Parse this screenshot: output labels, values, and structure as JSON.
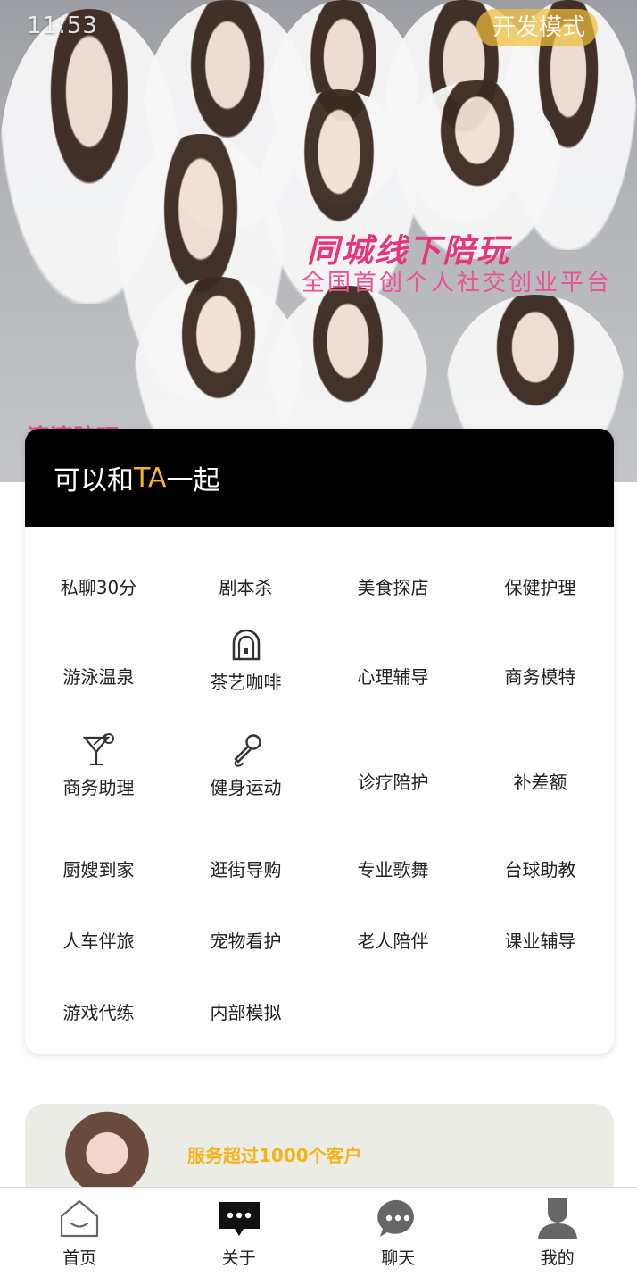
{
  "status_bar": {
    "time": "11:53"
  },
  "hero": {
    "dev_badge": "开发模式",
    "headline": "同城线下陪玩",
    "subline": "全国首创个人社交创业平台",
    "corner_text": "滴滴陪玩"
  },
  "card": {
    "title_prefix": "可以和",
    "title_accent": "TA",
    "title_suffix": "一起",
    "accent_color": "#f5b52a",
    "items": [
      {
        "label": "私聊30分"
      },
      {
        "label": "剧本杀"
      },
      {
        "label": "美食探店"
      },
      {
        "label": "保健护理"
      },
      {
        "label": "游泳温泉"
      },
      {
        "label": "茶艺咖啡",
        "icon": "door-lock-icon"
      },
      {
        "label": "心理辅导"
      },
      {
        "label": "商务模特"
      },
      {
        "label": "商务助理",
        "icon": "cocktail-icon"
      },
      {
        "label": "健身运动",
        "icon": "microphone-icon"
      },
      {
        "label": "诊疗陪护"
      },
      {
        "label": "补差额"
      },
      {
        "label": "厨嫂到家"
      },
      {
        "label": "逛街导购"
      },
      {
        "label": "专业歌舞"
      },
      {
        "label": "台球助教"
      },
      {
        "label": "人车伴旅"
      },
      {
        "label": "宠物看护"
      },
      {
        "label": "老人陪伴"
      },
      {
        "label": "课业辅导"
      },
      {
        "label": "游戏代练"
      },
      {
        "label": "内部模拟"
      }
    ]
  },
  "promo": {
    "text": "服务超过1000个客户",
    "color": "#f3b41b"
  },
  "nav": {
    "items": [
      {
        "label": "首页",
        "icon": "home-icon"
      },
      {
        "label": "关于",
        "icon": "message-icon"
      },
      {
        "label": "聊天",
        "icon": "chat-icon"
      },
      {
        "label": "我的",
        "icon": "user-icon"
      }
    ]
  }
}
